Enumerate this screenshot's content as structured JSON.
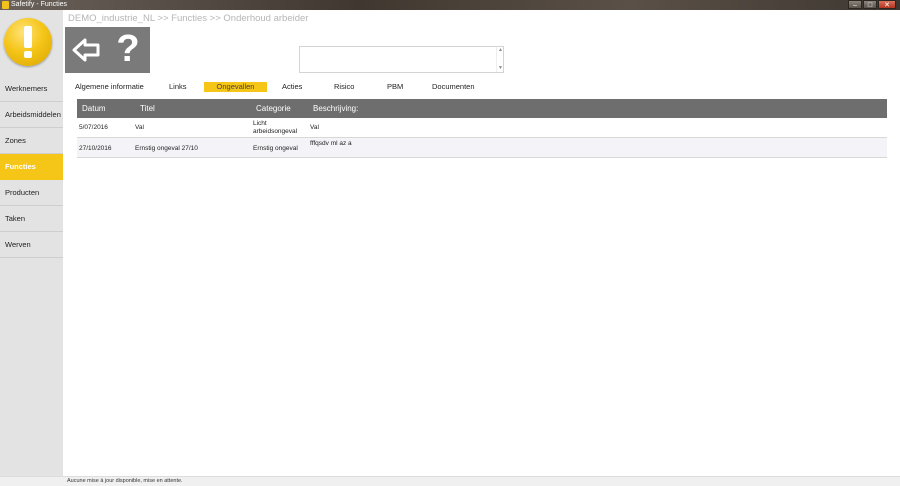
{
  "window": {
    "title": "Safetify - Functies"
  },
  "sidebar": {
    "items": [
      {
        "label": "Werknemers",
        "active": false
      },
      {
        "label": "Arbeidsmiddelen",
        "active": false
      },
      {
        "label": "Zones",
        "active": false
      },
      {
        "label": "Functies",
        "active": true
      },
      {
        "label": "Producten",
        "active": false
      },
      {
        "label": "Taken",
        "active": false
      },
      {
        "label": "Werven",
        "active": false
      }
    ]
  },
  "breadcrumb": "DEMO_industrie_NL >> Functies >> Onderhoud arbeider",
  "tabs": [
    {
      "label": "Algemene informatie",
      "active": false
    },
    {
      "label": "Links",
      "active": false
    },
    {
      "label": "Ongevallen",
      "active": true
    },
    {
      "label": "Acties",
      "active": false
    },
    {
      "label": "Risico",
      "active": false
    },
    {
      "label": "PBM",
      "active": false
    },
    {
      "label": "Documenten",
      "active": false
    }
  ],
  "table": {
    "columns": [
      "Datum",
      "Titel",
      "Categorie",
      "Beschrijving:"
    ],
    "rows": [
      {
        "datum": "5/07/2016",
        "titel": "Val",
        "categorie_line1": "Licht",
        "categorie_line2": "arbeidsongeval",
        "beschrijving": "Val"
      },
      {
        "datum": "27/10/2016",
        "titel": "Ernstig ongeval 27/10",
        "categorie_line1": "Ernstig ongeval",
        "categorie_line2": "",
        "beschrijving": "fffqsdv ml az a"
      }
    ]
  },
  "statusbar": {
    "text": "Aucune mise à jour disponible, mise en attente."
  },
  "colors": {
    "accent": "#f5c518",
    "header_gray": "#6e6e6e",
    "toolbox_gray": "#7a7a7a",
    "sidebar_bg": "#e3e3e3"
  }
}
